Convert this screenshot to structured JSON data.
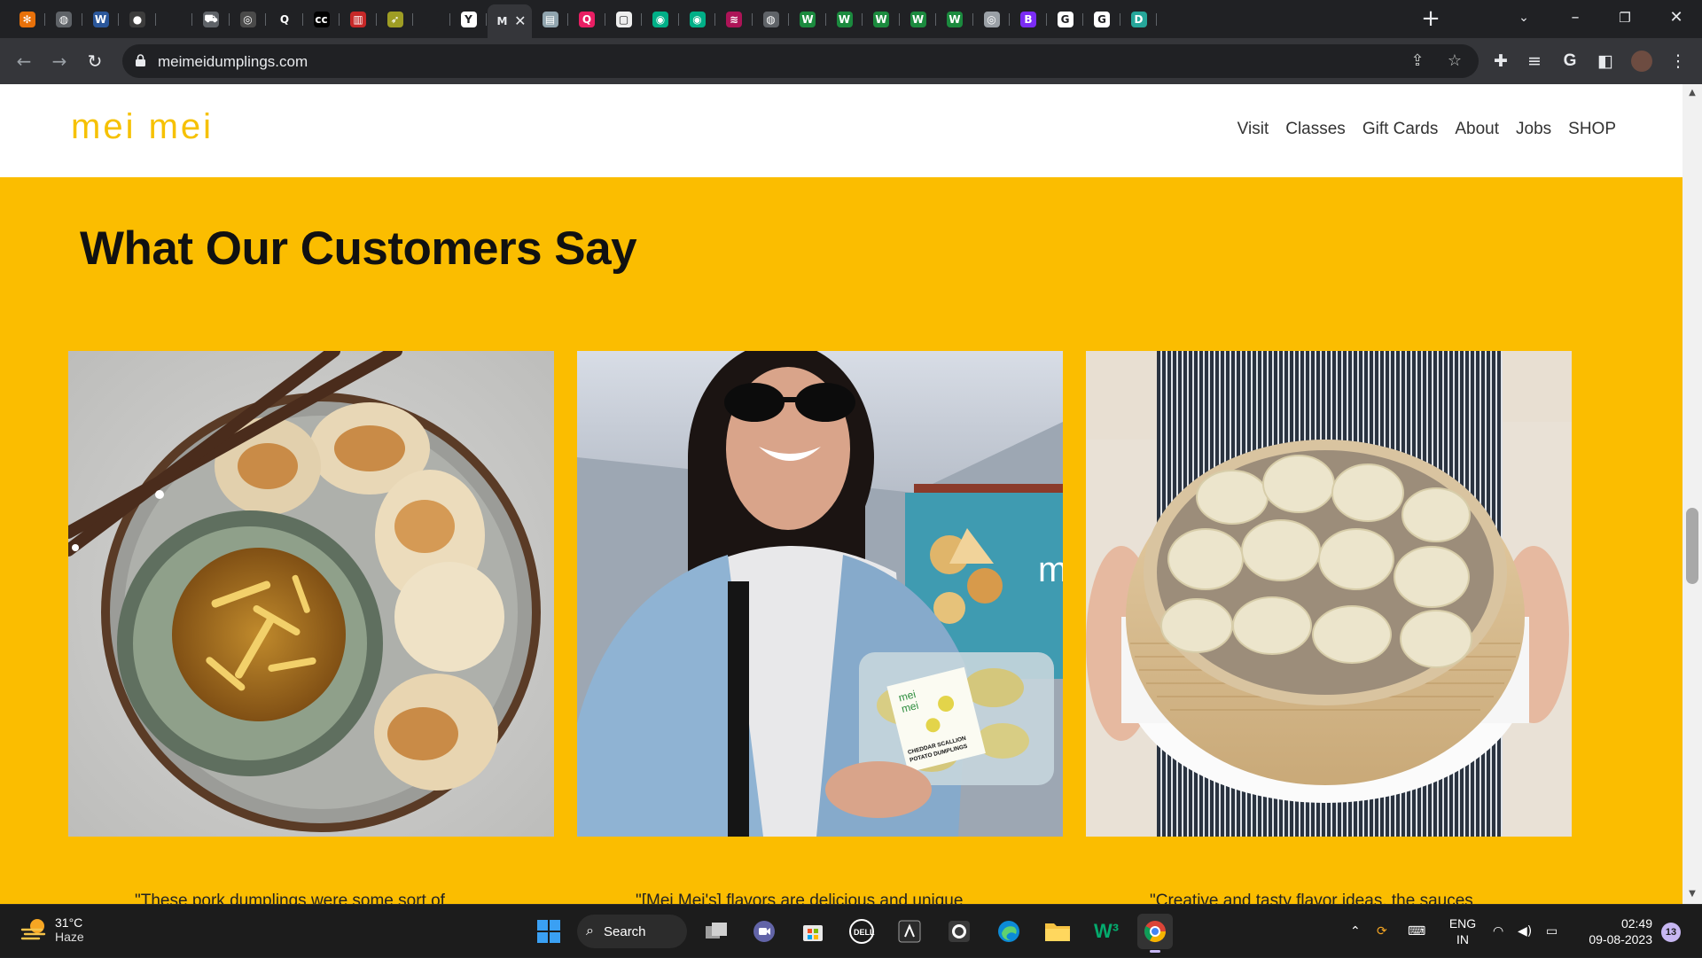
{
  "browser": {
    "url": "meimeidumplings.com",
    "tabs": [
      {
        "icon": "settings-orange-icon",
        "color": "#e8710a",
        "glyph": "✻"
      },
      {
        "icon": "globe-icon",
        "color": "#5f6368",
        "glyph": "◍"
      },
      {
        "icon": "word-icon",
        "color": "#2b579a",
        "glyph": "W"
      },
      {
        "icon": "dark-circle-icon",
        "color": "#3c3c3c",
        "glyph": "●"
      },
      {
        "icon": "blank-icon",
        "color": "#202124",
        "glyph": ""
      },
      {
        "icon": "car-icon",
        "color": "#5f6368",
        "glyph": "⛟"
      },
      {
        "icon": "seal-icon",
        "color": "#4a4a4a",
        "glyph": "◎"
      },
      {
        "icon": "quora-icon",
        "color": "#202124",
        "glyph": "Q"
      },
      {
        "icon": "cc-icon",
        "color": "#000000",
        "glyph": "cc"
      },
      {
        "icon": "red-book-icon",
        "color": "#c62828",
        "glyph": "▥"
      },
      {
        "icon": "leaf-icon",
        "color": "#9e9d24",
        "glyph": "➶"
      },
      {
        "icon": "blank-icon",
        "color": "#202124",
        "glyph": ""
      },
      {
        "icon": "y-icon",
        "color": "#ffffff",
        "glyph": "Y"
      },
      {
        "icon": "m-icon",
        "color": "#35363a",
        "glyph": "M",
        "active": true
      },
      {
        "icon": "doc-icon",
        "color": "#90a4ae",
        "glyph": "▤"
      },
      {
        "icon": "q-pink-icon",
        "color": "#e91e63",
        "glyph": "Q"
      },
      {
        "icon": "doc-white-icon",
        "color": "#eeeeee",
        "glyph": "▢"
      },
      {
        "icon": "tripadvisor-icon",
        "color": "#00af87",
        "glyph": "◉"
      },
      {
        "icon": "tripadvisor-icon",
        "color": "#00af87",
        "glyph": "◉"
      },
      {
        "icon": "stack-icon",
        "color": "#ad1457",
        "glyph": "≋"
      },
      {
        "icon": "globe-icon",
        "color": "#5f6368",
        "glyph": "◍"
      },
      {
        "icon": "w-green-icon",
        "color": "#1b8a3e",
        "glyph": "W"
      },
      {
        "icon": "w-green-icon",
        "color": "#1b8a3e",
        "glyph": "W"
      },
      {
        "icon": "w-green-icon",
        "color": "#1b8a3e",
        "glyph": "W"
      },
      {
        "icon": "w-green-icon",
        "color": "#1b8a3e",
        "glyph": "W"
      },
      {
        "icon": "w-green-icon",
        "color": "#1b8a3e",
        "glyph": "W"
      },
      {
        "icon": "chrome-icon",
        "color": "#9aa0a6",
        "glyph": "◎"
      },
      {
        "icon": "b-purple-icon",
        "color": "#7b2cf5",
        "glyph": "B"
      },
      {
        "icon": "google-icon",
        "color": "#ffffff",
        "glyph": "G"
      },
      {
        "icon": "google-icon",
        "color": "#ffffff",
        "glyph": "G"
      },
      {
        "icon": "d-teal-icon",
        "color": "#26a69a",
        "glyph": "D"
      }
    ]
  },
  "site": {
    "logo": "mei mei",
    "nav": [
      "Visit",
      "Classes",
      "Gift Cards",
      "About",
      "Jobs",
      "SHOP"
    ],
    "section_title": "What Our Customers Say",
    "quotes": [
      "\"These pork dumplings were some sort of",
      "\"[Mei Mei's] flavors are delicious and unique",
      "\"Creative and tasty flavor ideas, the sauces"
    ],
    "photo_names": [
      "fried-dumplings-photo",
      "customer-with-dumplings-photo",
      "steamer-basket-photo"
    ],
    "product_label": [
      "mei",
      "mei",
      "CHEDDAR SCALLION",
      "POTATO DUMPLINGS"
    ],
    "colors": {
      "accent": "#fbbd00",
      "logo": "#f6c100"
    }
  },
  "taskbar": {
    "weather_temp": "31°C",
    "weather_cond": "Haze",
    "search_label": "Search",
    "lang_top": "ENG",
    "lang_bottom": "IN",
    "time": "02:49",
    "date": "09-08-2023",
    "notifications": "13"
  }
}
